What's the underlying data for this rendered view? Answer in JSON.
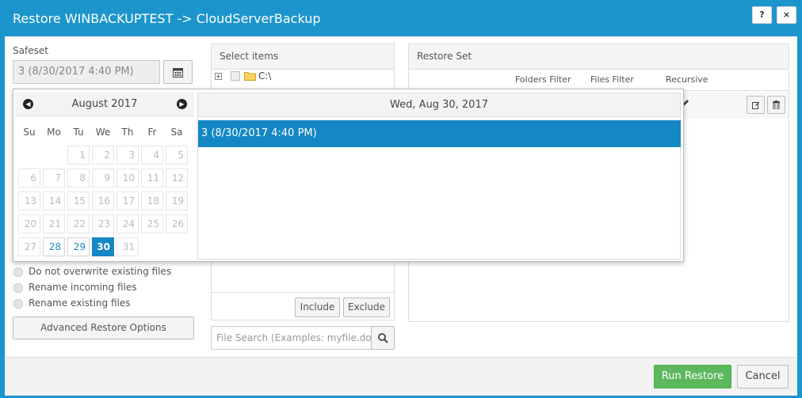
{
  "window": {
    "title": "Restore WINBACKUPTEST -> CloudServerBackup",
    "help_label": "?",
    "close_label": "×"
  },
  "safeset": {
    "label": "Safeset",
    "value": "3 (8/30/2017 4:40 PM)"
  },
  "select_items": {
    "header": "Select items",
    "tree_root": "C:\\",
    "include_label": "Include",
    "exclude_label": "Exclude",
    "search_placeholder": "File Search (Examples: myfile.doc, *.doc)"
  },
  "restore_set": {
    "header": "Restore Set",
    "columns": [
      "Folders Filter",
      "Files Filter",
      "Recursive"
    ]
  },
  "overwrite_options": [
    {
      "label": "Do not overwrite existing files"
    },
    {
      "label": "Rename incoming files"
    },
    {
      "label": "Rename existing files"
    }
  ],
  "advanced_button": "Advanced Restore Options",
  "calendar": {
    "month_label": "August 2017",
    "weekdays": [
      "Su",
      "Mo",
      "Tu",
      "We",
      "Th",
      "Fr",
      "Sa"
    ],
    "weeks": [
      [
        "",
        "",
        "1",
        "2",
        "3",
        "4",
        "5"
      ],
      [
        "6",
        "7",
        "8",
        "9",
        "10",
        "11",
        "12"
      ],
      [
        "13",
        "14",
        "15",
        "16",
        "17",
        "18",
        "19"
      ],
      [
        "20",
        "21",
        "22",
        "23",
        "24",
        "25",
        "26"
      ],
      [
        "27",
        "28",
        "29",
        "30",
        "31",
        "",
        ""
      ]
    ],
    "available_days": [
      "28",
      "29"
    ],
    "selected_day": "30",
    "selected_date_label": "Wed, Aug 30, 2017",
    "safesets_on_date": [
      "3 (8/30/2017 4:40 PM)"
    ]
  },
  "footer": {
    "run_label": "Run Restore",
    "cancel_label": "Cancel"
  },
  "colors": {
    "brand_blue": "#1c95cd",
    "selection_blue": "#1487c5",
    "run_green": "#5cb85c"
  }
}
